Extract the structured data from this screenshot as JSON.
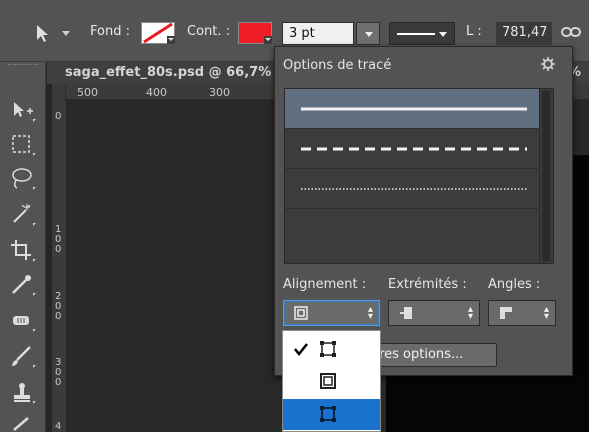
{
  "optionsbar": {
    "fill_label": "Fond :",
    "stroke_label": "Cont. :",
    "stroke_width": "3 pt",
    "length_label": "L :",
    "length_value": "781,47",
    "stroke_color": "#ef1d25"
  },
  "document": {
    "tab_title": "saga_effet_80s.psd @ 66,7%",
    "tab_title_right": "% (",
    "ruler_ticks": [
      "500",
      "400",
      "300"
    ],
    "vruler_labels": [
      "0",
      "1\n0\n0",
      "2\n0\n0",
      "3\n0\n0",
      "4"
    ]
  },
  "popup": {
    "title": "Options de tracé",
    "stroke_styles": [
      "solid",
      "dashed",
      "dotted",
      "empty"
    ],
    "alignment_label": "Alignement :",
    "caps_label": "Extrémités :",
    "corners_label": "Angles :",
    "more_options": "Autres options...",
    "more_options_visible": "tres options..."
  },
  "dropdown": {
    "items": [
      {
        "name": "align-inside",
        "checked": true,
        "highlighted": false
      },
      {
        "name": "align-center",
        "checked": false,
        "highlighted": false
      },
      {
        "name": "align-outside",
        "checked": false,
        "highlighted": true
      }
    ],
    "highlight_color": "#1b73d0"
  }
}
